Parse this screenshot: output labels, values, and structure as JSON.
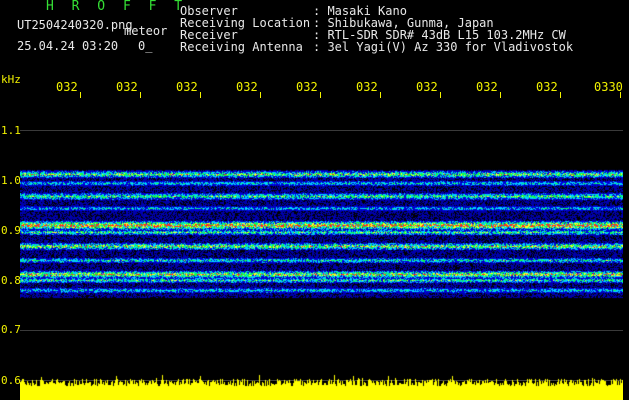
{
  "header": {
    "title": "H R O F F T",
    "file_name": "UT2504240320.png",
    "meteor_label": "meteor",
    "date_time": "25.04.24 03:20",
    "count_text": "0_"
  },
  "info": {
    "rows": [
      {
        "label": "Observer",
        "value": ": Masaki Kano"
      },
      {
        "label": "Receiving Location",
        "value": ": Shibukawa, Gunma, Japan"
      },
      {
        "label": "Receiver",
        "value": ": RTL-SDR SDR# 43dB L15 103.2MHz CW"
      },
      {
        "label": "Receiving Antenna",
        "value": ": 3el Yagi(V) Az 330 for Vladivostok"
      }
    ]
  },
  "axis": {
    "unit": "kHz",
    "x_ticks": [
      "032",
      "032",
      "032",
      "032",
      "032",
      "032",
      "032",
      "032",
      "032",
      "0330"
    ],
    "y_ticks": [
      "1.1",
      "1.0",
      "0.9",
      "0.8",
      "0.7",
      "0.6"
    ]
  },
  "colors": {
    "text": "#e8e8e8",
    "title": "#35e035",
    "axis": "#f2f200",
    "background": "#000000",
    "band_blue": "#1020ff",
    "band_cyan": "#10d0ff",
    "band_green": "#20ff40",
    "band_yellow": "#ffff30",
    "band_red": "#ff2020",
    "baseline": "#ffff00"
  }
}
